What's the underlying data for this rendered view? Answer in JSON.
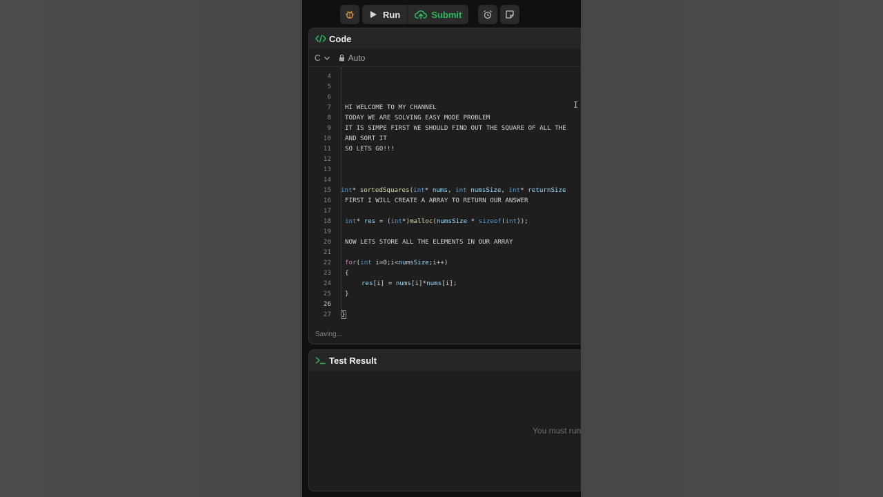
{
  "toolbar": {
    "run_label": "Run",
    "submit_label": "Submit",
    "colors": {
      "submit": "#2cbb5d",
      "accent_icon": "#d89b3c"
    }
  },
  "code_panel": {
    "title": "Code",
    "language": "C",
    "mode": "Auto",
    "status": "Saving...",
    "lines": [
      {
        "n": "4",
        "text": ""
      },
      {
        "n": "5",
        "text": ""
      },
      {
        "n": "6",
        "text": ""
      },
      {
        "n": "7",
        "text": "HI WELCOME TO MY CHANNEL"
      },
      {
        "n": "8",
        "text": "TODAY WE ARE SOLVING EASY MODE PROBLEM"
      },
      {
        "n": "9",
        "text": "IT IS SIMPE FIRST WE SHOULD FIND OUT THE SQUARE OF ALL THE"
      },
      {
        "n": "10",
        "text": "AND SORT IT"
      },
      {
        "n": "11",
        "text": "SO LETS GO!!!"
      },
      {
        "n": "12",
        "text": ""
      },
      {
        "n": "13",
        "text": ""
      },
      {
        "n": "14",
        "text": ""
      },
      {
        "n": "15",
        "text": "int* sortedSquares(int* nums, int numsSize, int* returnSize"
      },
      {
        "n": "16",
        "text": "FIRST I WILL CREATE A ARRAY TO RETURN OUR ANSWER"
      },
      {
        "n": "17",
        "text": ""
      },
      {
        "n": "18",
        "text": "int* res = (int*)malloc(numsSize * sizeof(int));"
      },
      {
        "n": "19",
        "text": ""
      },
      {
        "n": "20",
        "text": "NOW LETS STORE ALL THE ELEMENTS IN OUR ARRAY"
      },
      {
        "n": "21",
        "text": ""
      },
      {
        "n": "22",
        "text": "for(int i=0;i<numsSize;i++)"
      },
      {
        "n": "23",
        "text": "{"
      },
      {
        "n": "24",
        "text": "res[i] = nums[i]*nums[i];"
      },
      {
        "n": "25",
        "text": "}"
      },
      {
        "n": "26",
        "text": ""
      },
      {
        "n": "27",
        "text": "}"
      }
    ]
  },
  "test_panel": {
    "title": "Test Result",
    "message": "You must run"
  }
}
